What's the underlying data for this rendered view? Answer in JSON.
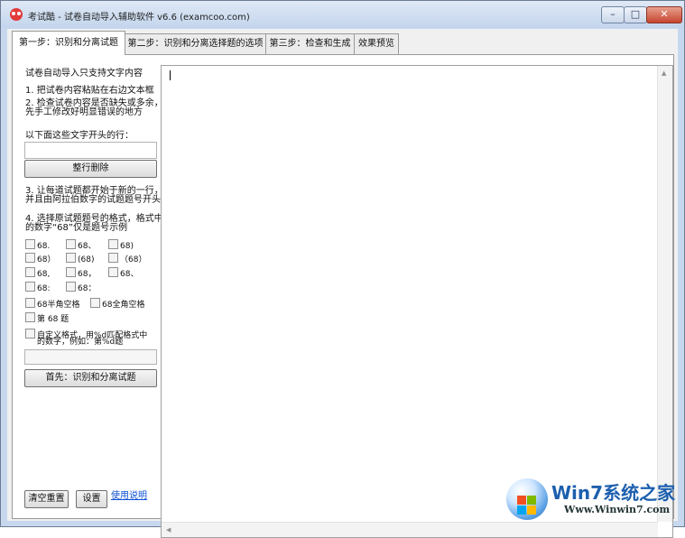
{
  "window": {
    "title": "考试酷 - 试卷自动导入辅助软件 v6.6 (examcoo.com)",
    "controls": {
      "minimize": "–",
      "maximize": "□",
      "close": "✕"
    }
  },
  "tabs": [
    {
      "label": "第一步：识别和分离试题",
      "active": true
    },
    {
      "label": "第二步：识别和分离选择题的选项",
      "active": false
    },
    {
      "label": "第三步：检查和生成",
      "active": false
    },
    {
      "label": "效果预览",
      "active": false
    }
  ],
  "left_panel": {
    "intro": "试卷自动导入只支持文字内容",
    "step1": "1. 把试卷内容粘贴在右边文本框",
    "step2_line1": "2. 检查试卷内容是否缺失或多余，",
    "step2_line2": "先手工修改好明显错误的地方",
    "prefix_label": "以下面这些文字开头的行：",
    "prefix_value": "",
    "delete_rows_button": "整行删除",
    "step3_line1": "3. 让每道试题都开始于新的一行，",
    "step3_line2": "并且由阿拉伯数字的试题题号开头",
    "step4_line1": "4. 选择原试题题号的格式，格式中",
    "step4_line2": "的数字“68”仅是题号示例",
    "formats": [
      [
        "68.",
        "68、",
        "68)"
      ],
      [
        "68）",
        "(68)",
        "（68）"
      ],
      [
        "68,",
        "68，",
        "68、"
      ],
      [
        "68:",
        "68："
      ]
    ],
    "space_half": "68半角空格",
    "space_full": "68全角空格",
    "di_ti": "第 68 题",
    "custom_line1": "自定义格式，用%d匹配格式中",
    "custom_line2": "的数字，例如：第%d题",
    "custom_value": "",
    "identify_button": "首先：识别和分离试题",
    "reset_button": "清空重置",
    "settings_button": "设置",
    "help_link": "使用说明"
  },
  "editor": {
    "content": ""
  },
  "scroll": {
    "up": "▲",
    "left": "◀"
  },
  "watermark": {
    "brand": "Win7系统之家",
    "url": "Www.Winwin7.com"
  },
  "colors": {
    "accent": "#1d5fae",
    "link": "#0b4fd3"
  }
}
